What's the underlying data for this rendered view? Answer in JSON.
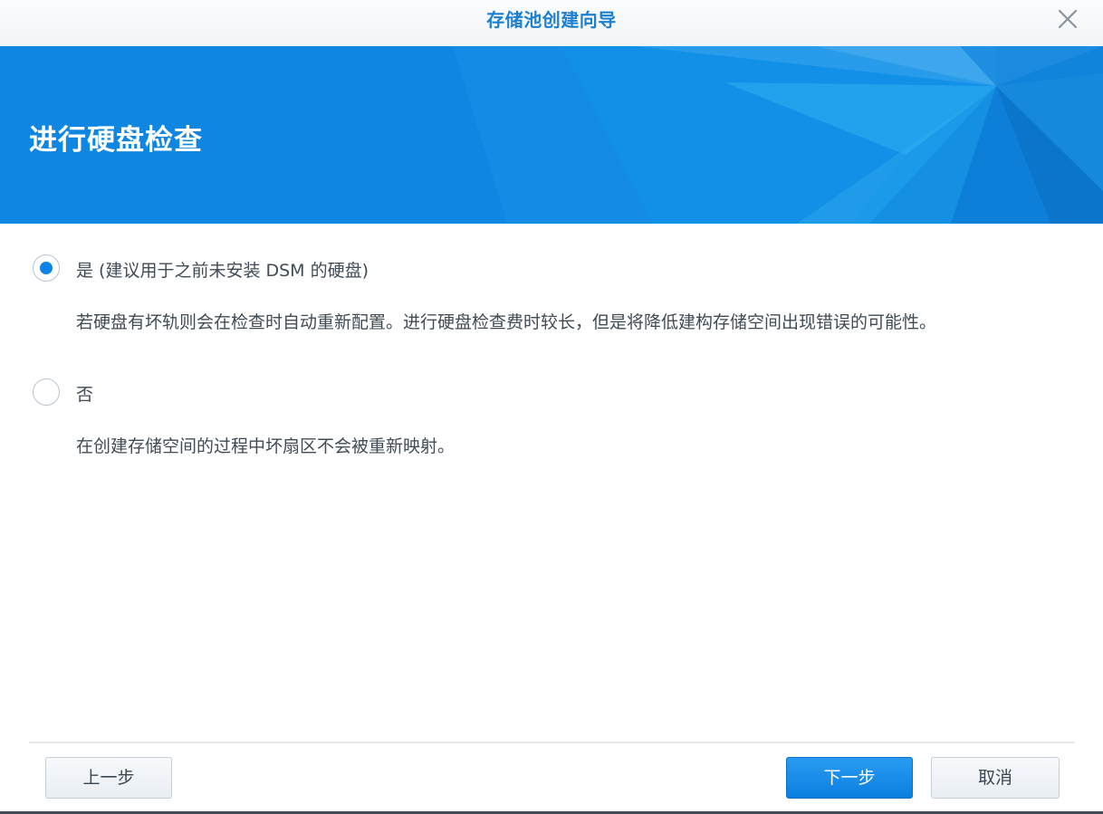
{
  "window": {
    "title": "存储池创建向导"
  },
  "banner": {
    "heading": "进行硬盘检查"
  },
  "options": [
    {
      "label": "是 (建议用于之前未安装 DSM 的硬盘)",
      "description": "若硬盘有坏轨则会在检查时自动重新配置。进行硬盘检查费时较长，但是将降低建构存储空间出现错误的可能性。",
      "selected": true
    },
    {
      "label": "否",
      "description": "在创建存储空间的过程中坏扇区不会被重新映射。",
      "selected": false
    }
  ],
  "footer": {
    "back_label": "上一步",
    "next_label": "下一步",
    "cancel_label": "取消"
  },
  "icons": {
    "close": "close-icon",
    "radio_selected": "radio-selected-icon",
    "radio_unselected": "radio-unselected-icon"
  },
  "colors": {
    "accent": "#0b84e6",
    "title_text": "#1d7fd0",
    "banner_bg": "#0f86e2",
    "body_text": "#414b55"
  }
}
